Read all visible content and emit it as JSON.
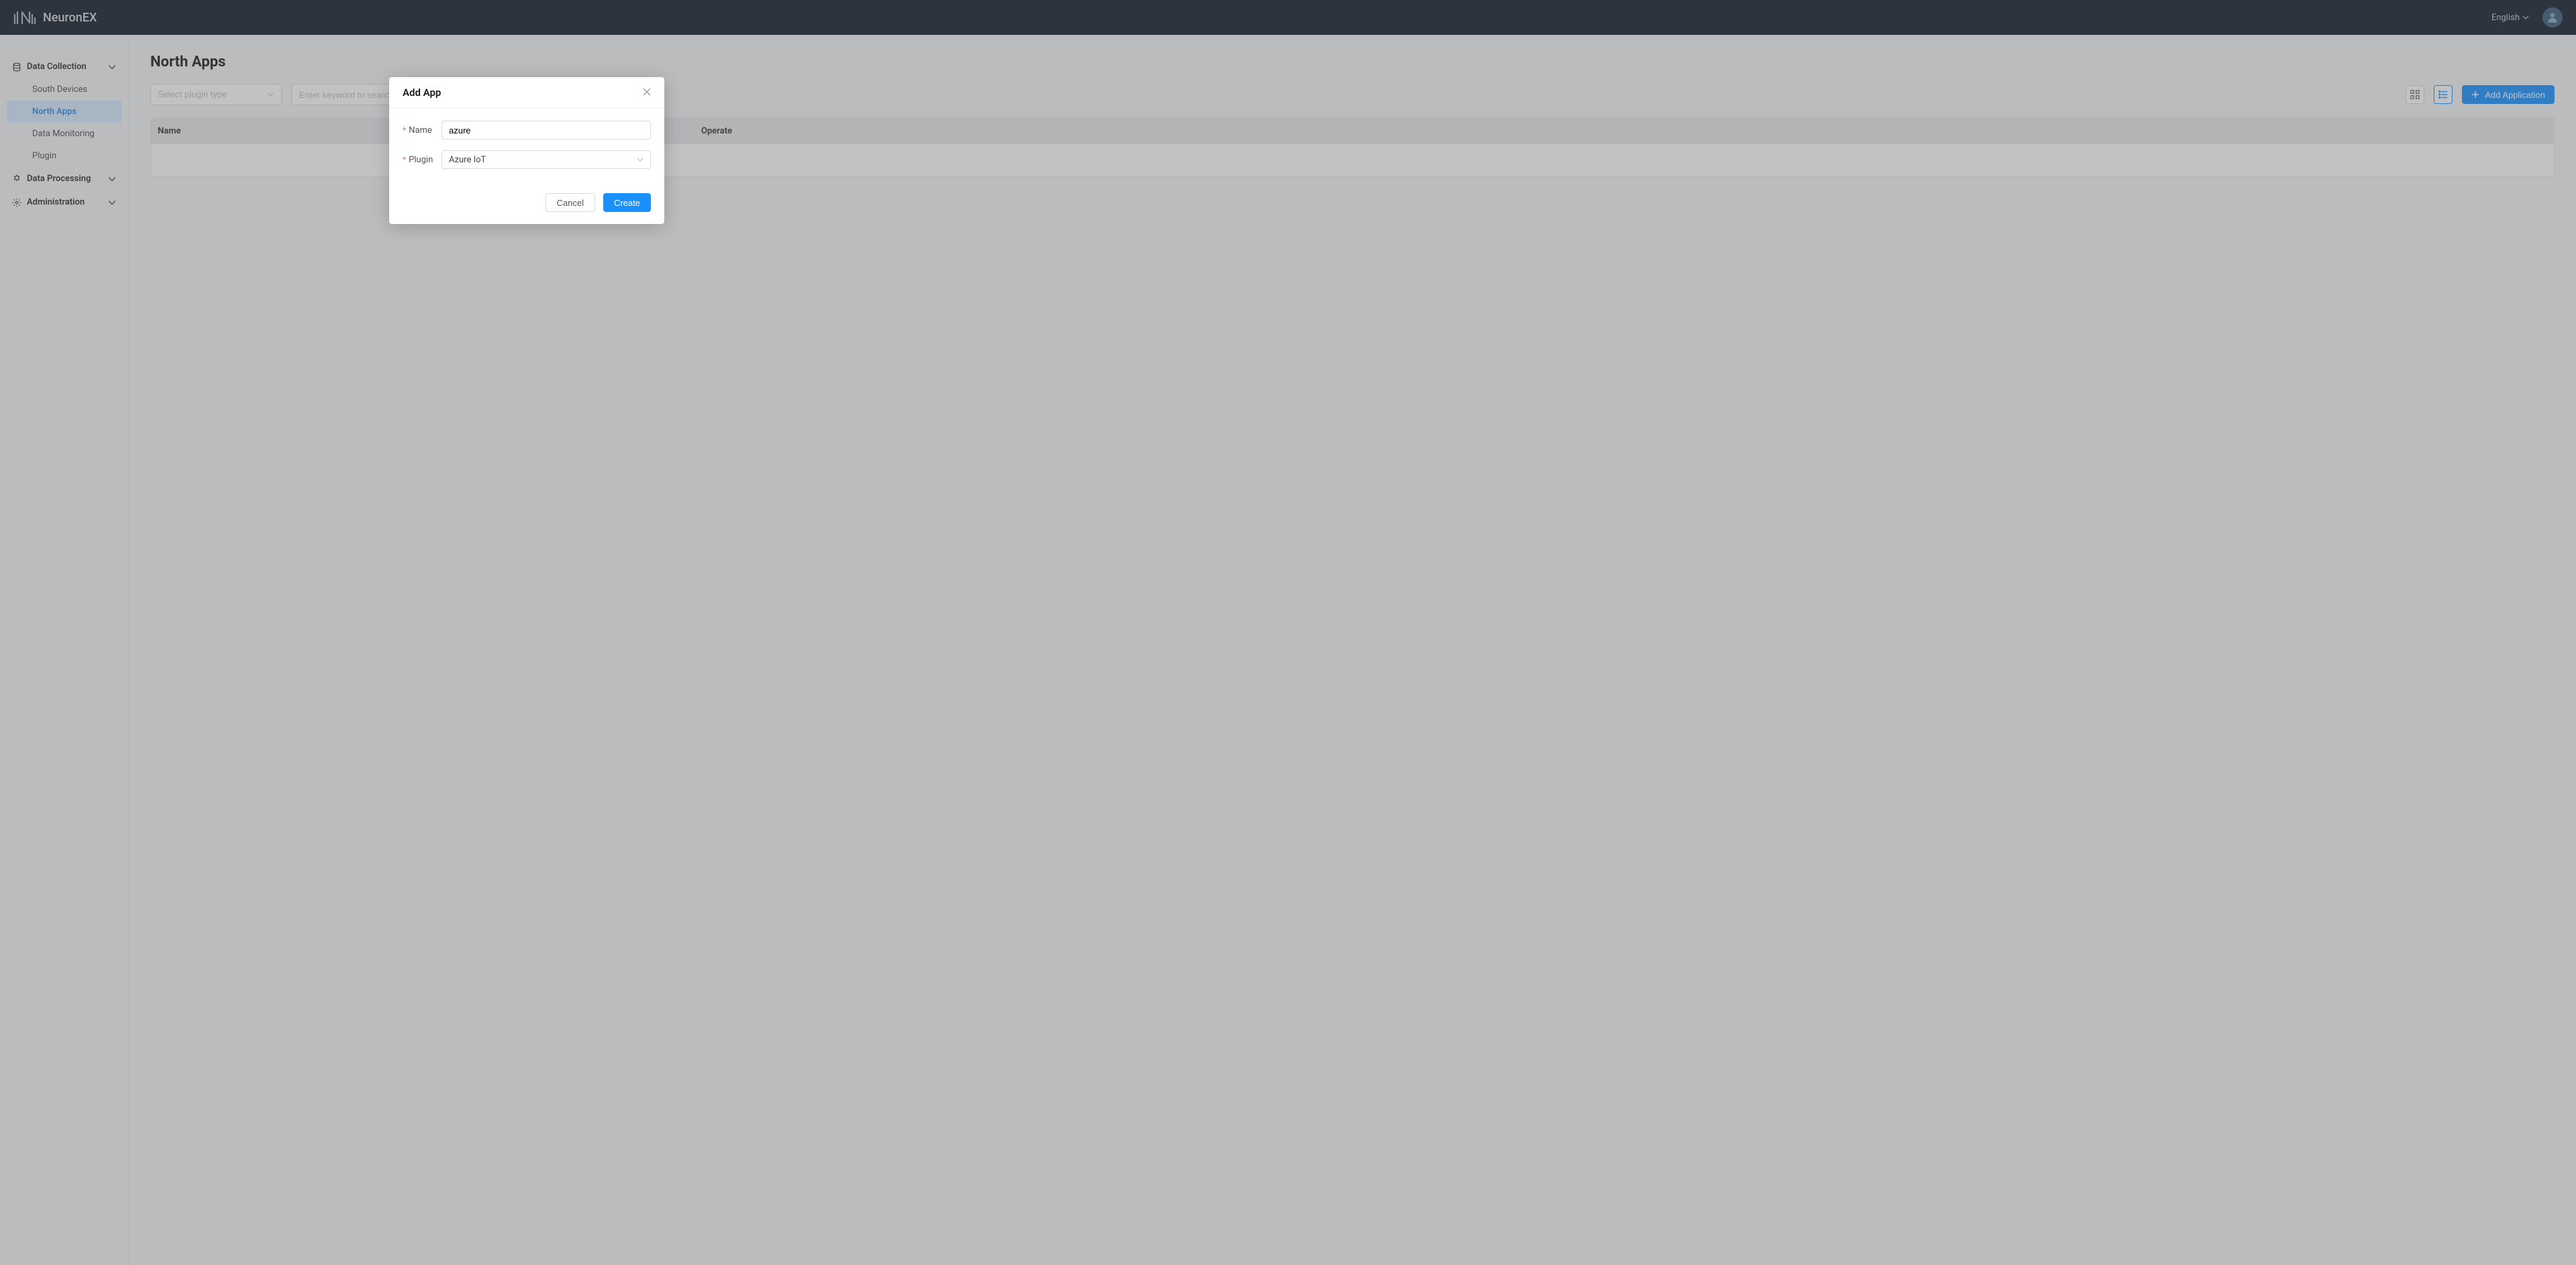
{
  "header": {
    "product": "NeuronEX",
    "lang": "English"
  },
  "sidebar": {
    "groups": [
      {
        "label": "Data Collection",
        "expanded": true,
        "items": [
          {
            "label": "South Devices",
            "active": false
          },
          {
            "label": "North Apps",
            "active": true
          },
          {
            "label": "Data Monitoring",
            "active": false
          },
          {
            "label": "Plugin",
            "active": false
          }
        ]
      },
      {
        "label": "Data Processing",
        "expanded": false,
        "items": []
      },
      {
        "label": "Administration",
        "expanded": false,
        "items": []
      }
    ]
  },
  "page": {
    "title": "North Apps",
    "plugin_select_placeholder": "Select plugin type",
    "search_placeholder": "Enter keyword to search",
    "add_button": "Add Application",
    "table": {
      "columns": {
        "name": "Name",
        "operate": "Operate"
      }
    }
  },
  "modal": {
    "title": "Add App",
    "name_label": "Name",
    "name_value": "azure",
    "plugin_label": "Plugin",
    "plugin_value": "Azure IoT",
    "cancel": "Cancel",
    "create": "Create"
  }
}
